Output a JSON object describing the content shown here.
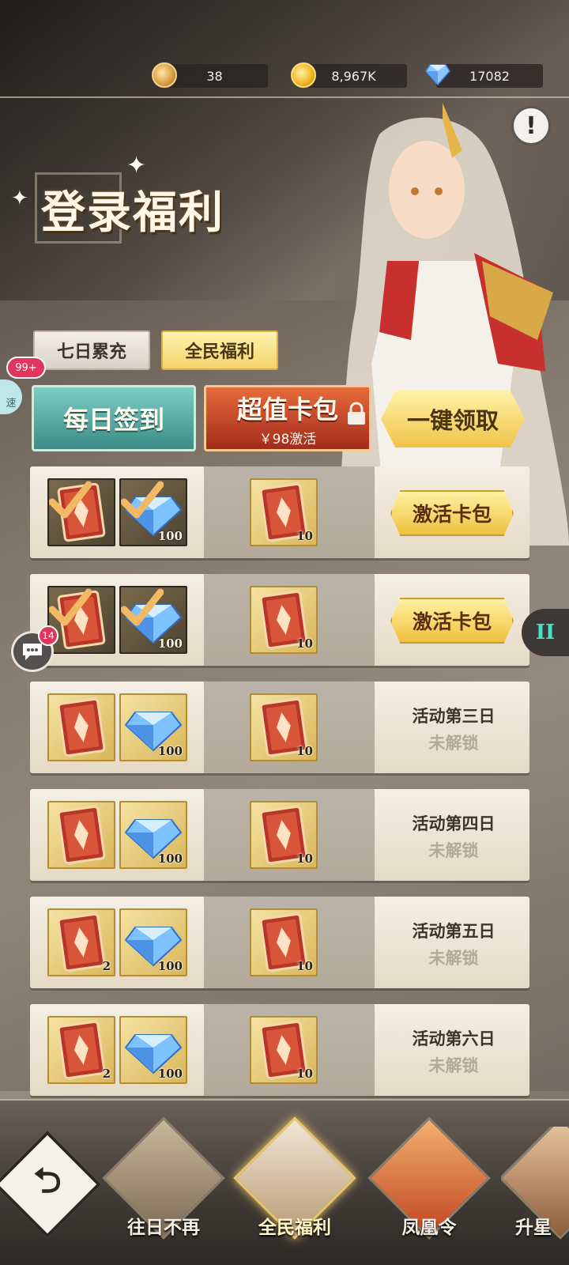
{
  "currency": {
    "token": "38",
    "gold": "8,967K",
    "gems": "17082"
  },
  "info_button": "!",
  "page_title": "登录福利",
  "tabs": [
    {
      "label": "七日累充"
    },
    {
      "label": "全民福利"
    }
  ],
  "side_badge": "99+",
  "side_speed_label": "速",
  "buttons": {
    "daily_signin": "每日签到",
    "value_pack": "超值卡包",
    "value_pack_price": "￥98激活",
    "claim_all": "一键领取"
  },
  "rows": [
    {
      "items": [
        {
          "kind": "card",
          "qty": "",
          "claimed": true
        },
        {
          "kind": "gem",
          "qty": "100",
          "claimed": true
        }
      ],
      "pack_qty": "10",
      "action": "激活卡包"
    },
    {
      "items": [
        {
          "kind": "card",
          "qty": "",
          "claimed": true
        },
        {
          "kind": "gem",
          "qty": "100",
          "claimed": true
        }
      ],
      "pack_qty": "10",
      "action": "激活卡包"
    },
    {
      "items": [
        {
          "kind": "card",
          "qty": ""
        },
        {
          "kind": "gem",
          "qty": "100"
        }
      ],
      "pack_qty": "10",
      "day": "活动第三日",
      "status": "未解锁"
    },
    {
      "items": [
        {
          "kind": "card",
          "qty": ""
        },
        {
          "kind": "gem",
          "qty": "100"
        }
      ],
      "pack_qty": "10",
      "day": "活动第四日",
      "status": "未解锁"
    },
    {
      "items": [
        {
          "kind": "card",
          "qty": "2"
        },
        {
          "kind": "gem",
          "qty": "100"
        }
      ],
      "pack_qty": "10",
      "day": "活动第五日",
      "status": "未解锁"
    },
    {
      "items": [
        {
          "kind": "card",
          "qty": "2"
        },
        {
          "kind": "gem",
          "qty": "100"
        }
      ],
      "pack_qty": "10",
      "day": "活动第六日",
      "status": "未解锁"
    }
  ],
  "chat_badge": "14",
  "pause_label": "II",
  "bottom_nav": [
    {
      "label": "往日不再"
    },
    {
      "label": "全民福利"
    },
    {
      "label": "凤凰令"
    },
    {
      "label": "升星"
    }
  ],
  "colors": {
    "accent_gold": "#f0c348",
    "teal_button": "#3b8b86",
    "red_button": "#a22b1a",
    "badge_red": "#e0355d"
  }
}
